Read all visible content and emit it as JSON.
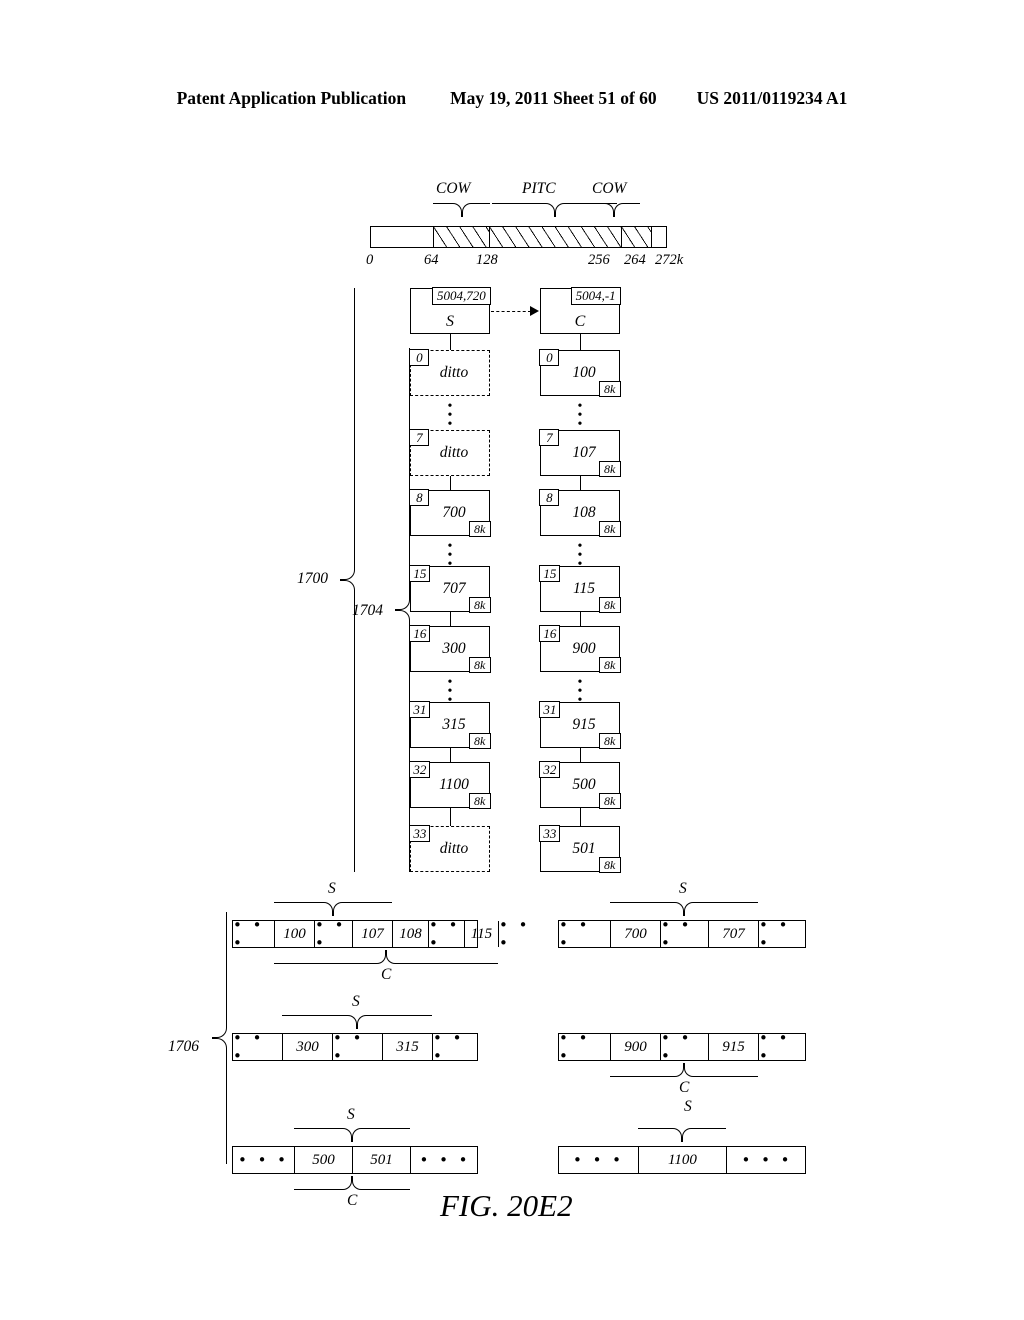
{
  "header": {
    "publication": "Patent Application Publication",
    "date_sheet": "May 19, 2011  Sheet 51 of 60",
    "patent_number": "US 2011/0119234 A1"
  },
  "figure": {
    "caption": "FIG. 20E2"
  },
  "memory_bar": {
    "region_labels": [
      {
        "text": "COW"
      },
      {
        "text": "PITC"
      },
      {
        "text": "COW"
      }
    ],
    "tick_labels": [
      "0",
      "64",
      "128",
      "256",
      "264",
      "272k"
    ]
  },
  "reference_numerals": {
    "outer": "1700",
    "list": "1704",
    "rows": "1706"
  },
  "head_nodes": {
    "left": {
      "tag": "5004,720",
      "name": "S"
    },
    "right": {
      "tag": "5004,-1",
      "name": "C"
    }
  },
  "left_column": [
    {
      "index": "0",
      "value": "ditto",
      "size": "",
      "style": "dashed"
    },
    {
      "index": "7",
      "value": "ditto",
      "size": "",
      "style": "dashed"
    },
    {
      "index": "8",
      "value": "700",
      "size": "8k",
      "style": "solid"
    },
    {
      "index": "15",
      "value": "707",
      "size": "8k",
      "style": "solid"
    },
    {
      "index": "16",
      "value": "300",
      "size": "8k",
      "style": "solid"
    },
    {
      "index": "31",
      "value": "315",
      "size": "8k",
      "style": "solid"
    },
    {
      "index": "32",
      "value": "1100",
      "size": "8k",
      "style": "solid"
    },
    {
      "index": "33",
      "value": "ditto",
      "size": "",
      "style": "dashed"
    }
  ],
  "right_column": [
    {
      "index": "0",
      "value": "100",
      "size": "8k",
      "style": "solid"
    },
    {
      "index": "7",
      "value": "107",
      "size": "8k",
      "style": "solid"
    },
    {
      "index": "8",
      "value": "108",
      "size": "8k",
      "style": "solid"
    },
    {
      "index": "15",
      "value": "115",
      "size": "8k",
      "style": "solid"
    },
    {
      "index": "16",
      "value": "900",
      "size": "8k",
      "style": "solid"
    },
    {
      "index": "31",
      "value": "915",
      "size": "8k",
      "style": "solid"
    },
    {
      "index": "32",
      "value": "500",
      "size": "8k",
      "style": "solid"
    },
    {
      "index": "33",
      "value": "501",
      "size": "8k",
      "style": "solid"
    }
  ],
  "bottom_rows": {
    "left": [
      {
        "cells": [
          "• • •",
          "100",
          "• • •",
          "107",
          "108",
          "• • •",
          "115",
          "• • •"
        ],
        "brace_above": "S",
        "brace_below": "C"
      },
      {
        "cells": [
          "• • •",
          "300",
          "• • •",
          "315",
          "• • •"
        ],
        "brace_above": "S",
        "brace_below": ""
      },
      {
        "cells": [
          "• • •",
          "500",
          "501",
          "• • •"
        ],
        "brace_above": "S",
        "brace_below": "C"
      }
    ],
    "right": [
      {
        "cells": [
          "• • •",
          "700",
          "• • •",
          "707",
          "• • •"
        ],
        "brace_above": "S",
        "brace_below": ""
      },
      {
        "cells": [
          "• • •",
          "900",
          "• • •",
          "915",
          "• • •"
        ],
        "brace_above": "",
        "brace_below": "C"
      },
      {
        "cells": [
          "• • •",
          "1100",
          "• • •"
        ],
        "brace_above": "",
        "brace_below": ""
      }
    ],
    "interlabels": {
      "left_c": "C",
      "left_s": "S",
      "right_c": "C",
      "right_s": "S"
    }
  }
}
